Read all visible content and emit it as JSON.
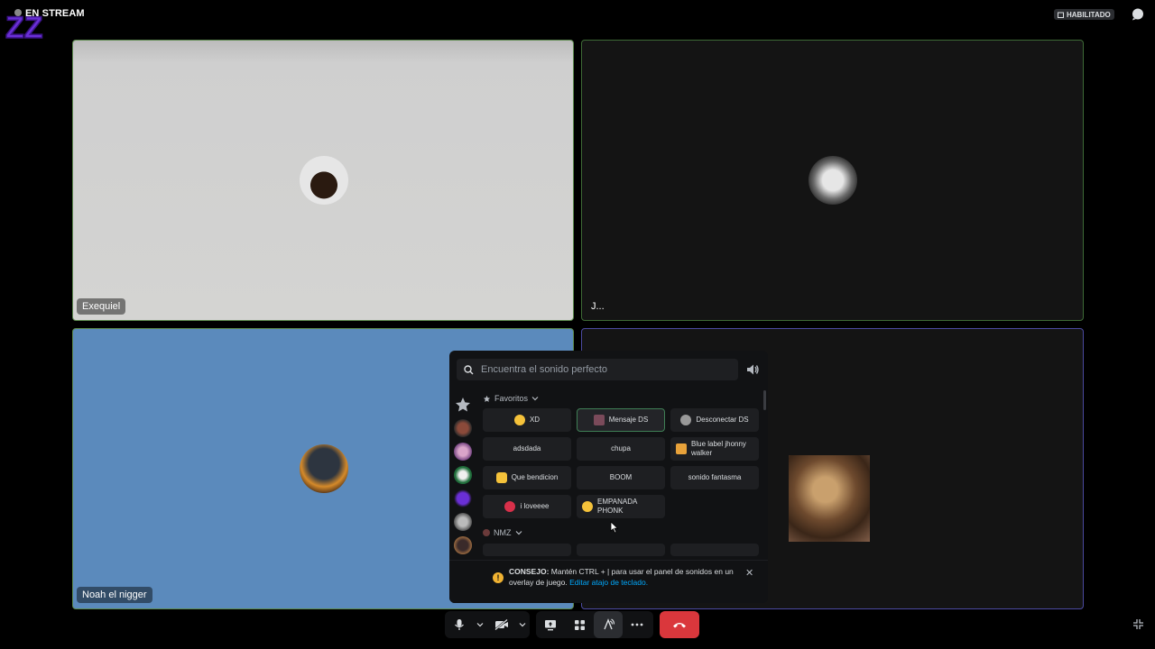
{
  "header": {
    "stream_label": "EN STREAM",
    "status_badge": "HABILITADO"
  },
  "tiles": [
    {
      "name": "Exequiel",
      "border_color": "#5c8a4e"
    },
    {
      "name": "J...",
      "border_color": "#3e6a36"
    },
    {
      "name": "Noah el nigger",
      "border_color": "#5c8a4e"
    },
    {
      "name": "",
      "border_color": "#4b4aa0"
    }
  ],
  "soundboard": {
    "search_placeholder": "Encuentra el sonido perfecto",
    "categories": [
      {
        "name": "Favoritos",
        "sounds": [
          {
            "label": "XD",
            "icon": "laughing-emoji-icon"
          },
          {
            "label": "Mensaje DS",
            "icon": "image-icon",
            "active": true
          },
          {
            "label": "Desconectar DS",
            "icon": "circle-avatar-icon"
          },
          {
            "label": "adsdada",
            "icon": ""
          },
          {
            "label": "chupa",
            "icon": ""
          },
          {
            "label": "Blue label jhonny walker",
            "icon": "beer-icon"
          },
          {
            "label": "Que bendicion",
            "icon": "praying-hands-icon"
          },
          {
            "label": "BOOM",
            "icon": ""
          },
          {
            "label": "sonido fantasma",
            "icon": ""
          },
          {
            "label": "i loveeee",
            "icon": "lips-icon"
          },
          {
            "label": "EMPANADA PHONK",
            "icon": "smiley-icon"
          }
        ]
      },
      {
        "name": "NMZ",
        "sounds": []
      }
    ],
    "tip": {
      "bold": "CONSEJO:",
      "text": " Mantén CTRL + | para usar el panel de sonidos en un overlay de juego. ",
      "link": "Editar atajo de teclado."
    }
  },
  "colors": {
    "accent_green": "#3f7f55",
    "hangup_red": "#da373c",
    "link_blue": "#00a8fc"
  },
  "toolbar": {
    "buttons": [
      "microphone-icon",
      "chevron-down-icon",
      "camera-off-icon",
      "chevron-down-icon",
      "screen-share-icon",
      "activities-icon",
      "soundboard-icon",
      "more-icon"
    ],
    "hangup": "hang-up-icon"
  }
}
